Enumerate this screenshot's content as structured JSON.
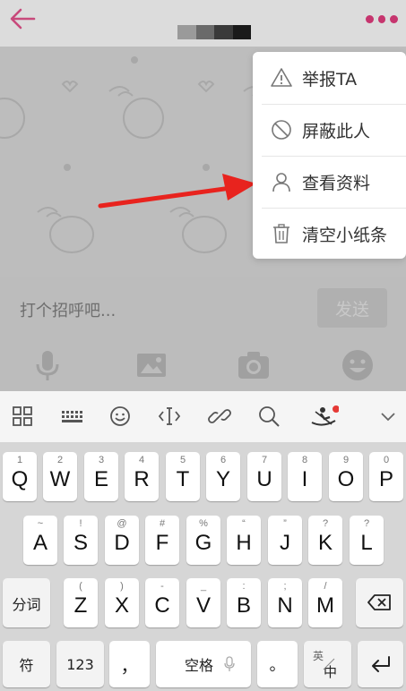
{
  "topbar": {
    "back_icon": "arrow-left-icon",
    "more_icon": "more-dots-icon",
    "accent": "#c2185b"
  },
  "chat": {
    "input_placeholder": "打个招呼吧...",
    "send_label": "发送",
    "tools": [
      "microphone-icon",
      "image-icon",
      "camera-icon",
      "emoji-icon"
    ]
  },
  "menu": {
    "items": [
      {
        "label": "举报TA",
        "icon": "warning-icon"
      },
      {
        "label": "屏蔽此人",
        "icon": "block-icon"
      },
      {
        "label": "查看资料",
        "icon": "user-icon"
      },
      {
        "label": "清空小纸条",
        "icon": "trash-icon"
      }
    ]
  },
  "keyboard_toolbar": {
    "icons": [
      "grid-icon",
      "keyboard-icon",
      "smiley-icon",
      "cursor-icon",
      "link-icon",
      "search-icon",
      "rower-icon",
      "chevron-down-icon"
    ]
  },
  "keyboard": {
    "row1": [
      {
        "main": "Q",
        "sub": "1"
      },
      {
        "main": "W",
        "sub": "2"
      },
      {
        "main": "E",
        "sub": "3"
      },
      {
        "main": "R",
        "sub": "4"
      },
      {
        "main": "T",
        "sub": "5"
      },
      {
        "main": "Y",
        "sub": "6"
      },
      {
        "main": "U",
        "sub": "7"
      },
      {
        "main": "I",
        "sub": "8"
      },
      {
        "main": "O",
        "sub": "9"
      },
      {
        "main": "P",
        "sub": "0"
      }
    ],
    "row2": [
      {
        "main": "A",
        "sub": "~"
      },
      {
        "main": "S",
        "sub": "!"
      },
      {
        "main": "D",
        "sub": "@"
      },
      {
        "main": "F",
        "sub": "#"
      },
      {
        "main": "G",
        "sub": "%"
      },
      {
        "main": "H",
        "sub": "“"
      },
      {
        "main": "J",
        "sub": "”"
      },
      {
        "main": "K",
        "sub": "?"
      },
      {
        "main": "L",
        "sub": "?"
      }
    ],
    "row3": [
      {
        "main": "Z",
        "sub": "("
      },
      {
        "main": "X",
        "sub": ")"
      },
      {
        "main": "C",
        "sub": "-"
      },
      {
        "main": "V",
        "sub": "_"
      },
      {
        "main": "B",
        "sub": ":"
      },
      {
        "main": "N",
        "sub": ";"
      },
      {
        "main": "M",
        "sub": "/"
      }
    ],
    "fenci": "分词",
    "symbol": "符",
    "num": "123",
    "comma": "，",
    "space": "空格",
    "period": "。",
    "lang_top": "英",
    "lang_bottom": "中"
  }
}
